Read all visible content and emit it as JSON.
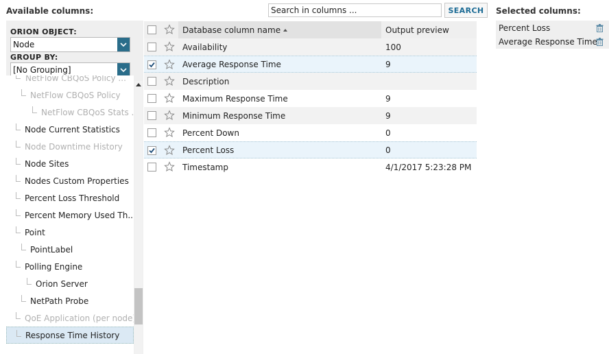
{
  "header": {
    "available_title": "Available columns:",
    "selected_title": "Selected columns:"
  },
  "search": {
    "value": "Search in columns ...",
    "button_label": "SEARCH"
  },
  "left": {
    "orion_object_label": "ORION OBJECT:",
    "orion_object_value": "Node",
    "group_by_label": "GROUP BY:",
    "group_by_value": "[No Grouping]",
    "tree": [
      {
        "label": "NetFlow CBQoS Policy ...",
        "dim": true
      },
      {
        "label": "NetFlow CBQoS Policy",
        "dim": true
      },
      {
        "label": "NetFlow CBQoS Stats ...",
        "dim": true
      },
      {
        "label": "Node Current Statistics",
        "dim": false
      },
      {
        "label": "Node Downtime History",
        "dim": true
      },
      {
        "label": "Node Sites",
        "dim": false
      },
      {
        "label": "Nodes Custom Properties",
        "dim": false
      },
      {
        "label": "Percent Loss Threshold",
        "dim": false
      },
      {
        "label": "Percent Memory Used Th...",
        "dim": false
      },
      {
        "label": "Point",
        "dim": false
      },
      {
        "label": "PointLabel",
        "dim": false
      },
      {
        "label": "Polling Engine",
        "dim": false
      },
      {
        "label": "Orion Server",
        "dim": false
      },
      {
        "label": "NetPath Probe",
        "dim": false
      },
      {
        "label": "QoE Application (per node)",
        "dim": true
      },
      {
        "label": "Response Time History",
        "dim": false,
        "selected": true
      }
    ]
  },
  "grid": {
    "col_name": "Database column name",
    "col_preview": "Output preview",
    "rows": [
      {
        "name": "Availability",
        "preview": "100",
        "checked": false
      },
      {
        "name": "Average Response Time",
        "preview": "9",
        "checked": true
      },
      {
        "name": "Description",
        "preview": "",
        "checked": false
      },
      {
        "name": "Maximum Response Time",
        "preview": "9",
        "checked": false
      },
      {
        "name": "Minimum Response Time",
        "preview": "9",
        "checked": false
      },
      {
        "name": "Percent Down",
        "preview": "0",
        "checked": false
      },
      {
        "name": "Percent Loss",
        "preview": "0",
        "checked": true
      },
      {
        "name": "Timestamp",
        "preview": "4/1/2017 5:23:28 PM",
        "checked": false
      }
    ]
  },
  "selected": {
    "items": [
      "Percent Loss",
      "Average Response Time"
    ]
  },
  "colors": {
    "accent": "#2a6d8a",
    "search_text": "#1a6a94",
    "checked_row": "#eaf4fb"
  }
}
